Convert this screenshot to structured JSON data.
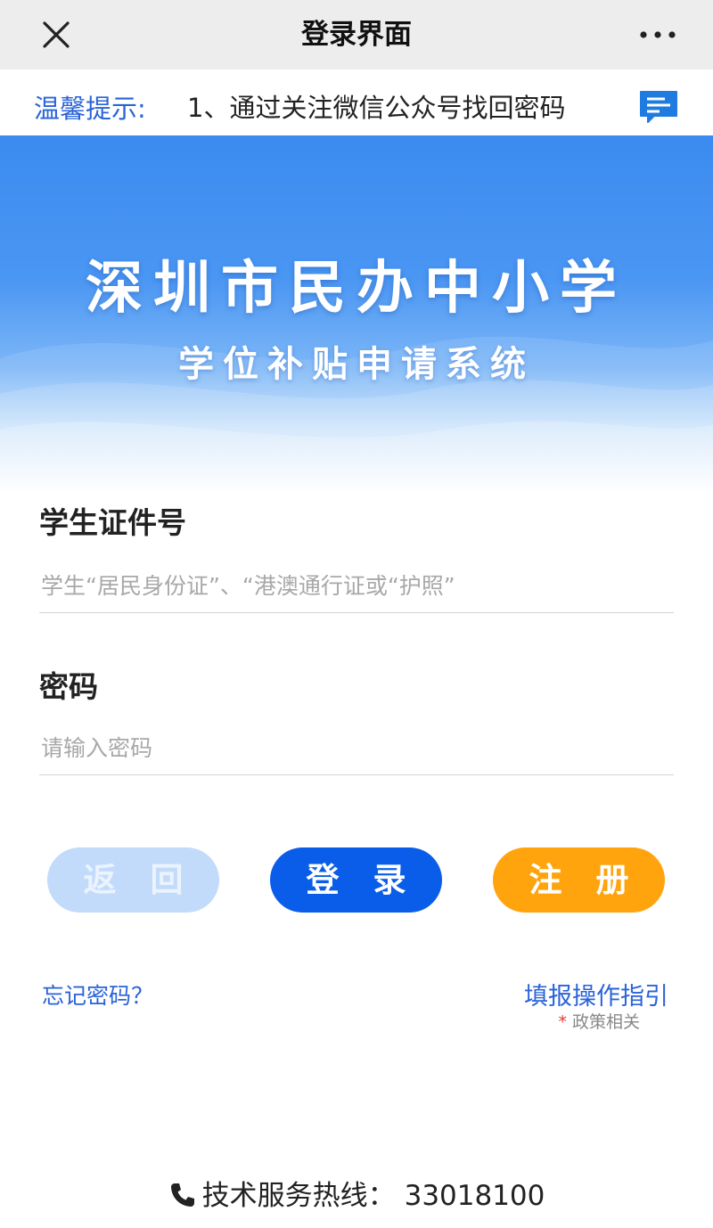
{
  "header": {
    "title": "登录界面",
    "close_icon": "close-icon",
    "more_icon": "more-dots-icon"
  },
  "notice": {
    "label": "温馨提示:",
    "text": "1、通过关注微信公众号找回密码",
    "message_icon": "message-icon"
  },
  "banner": {
    "title": "深圳市民办中小学",
    "subtitle": "学位补贴申请系统"
  },
  "form": {
    "id_label": "学生证件号",
    "id_placeholder": "学生“居民身份证”、“港澳通行证或“护照”",
    "id_value": "",
    "password_label": "密码",
    "password_placeholder": "请输入密码",
    "password_value": ""
  },
  "buttons": {
    "back": "返回",
    "login": "登录",
    "register": "注册"
  },
  "links": {
    "forgot": "忘记密码？",
    "guide": "填报操作指引",
    "policy_note": "政策相关",
    "policy_star": "*"
  },
  "footer": {
    "hotline_label": "技术服务热线：",
    "hotline_number": "33018100",
    "phone_icon": "phone-icon"
  },
  "colors": {
    "accent": "#2a63d9",
    "login_button": "#0a5de8",
    "register_button": "#ffa40d",
    "back_button": "#c3dbfa",
    "header_background": "#ededed"
  }
}
